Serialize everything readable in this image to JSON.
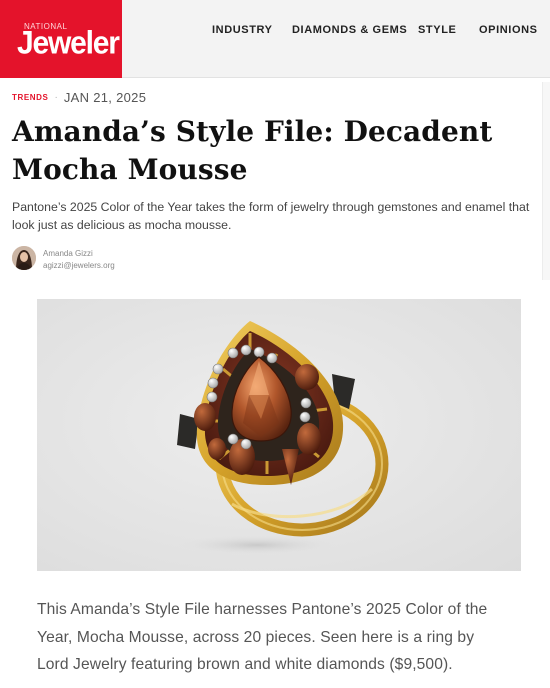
{
  "header": {
    "logo_top": "NATIONAL",
    "logo_main": "Jeweler",
    "nav": [
      "INDUSTRY",
      "DIAMONDS & GEMS",
      "STYLE",
      "OPINIONS"
    ]
  },
  "article": {
    "category": "TRENDS",
    "separator": "·",
    "date": "JAN 21, 2025",
    "title": "Amanda’s Style File: Decadent Mocha Mousse",
    "dek": "Pantone’s 2025 Color of the Year takes the form of jewelry through gemstones and enamel that look just as delicious as mocha mousse.",
    "author": {
      "name": "Amanda Gizzi",
      "email": "agizzi@jewelers.org"
    },
    "image": {
      "subject": "gold-pear-shaped-ring"
    },
    "caption": "This Amanda’s Style File harnesses Pantone’s 2025 Color of the Year, Mocha Mousse, across 20 pieces. Seen here is a ring by Lord Jewelry featuring brown and white diamonds ($9,500)."
  },
  "colors": {
    "brand_red": "#e4132b",
    "header_bg": "#f3f3f3",
    "photo_bg": "#e5e5e5",
    "gold": "#d9a82a",
    "enamel": "#6b2a1c"
  }
}
